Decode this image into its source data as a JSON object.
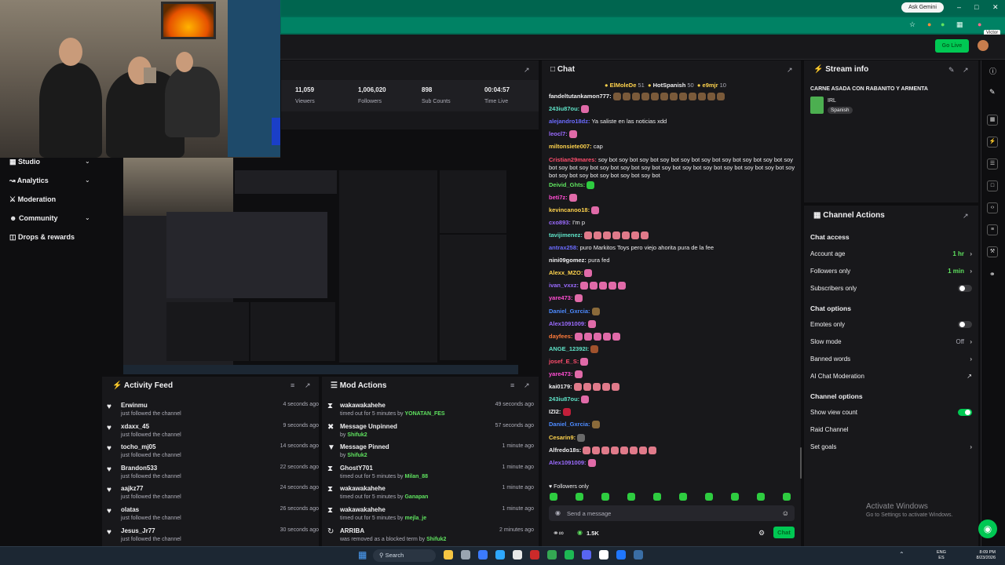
{
  "browser": {
    "gemini_label": "Ask Gemini",
    "tooltip": "Victor",
    "go_live": "Go Live"
  },
  "sidebar": {
    "items": [
      {
        "label": "Studio",
        "chevron": true
      },
      {
        "label": "Analytics",
        "chevron": true
      },
      {
        "label": "Moderation",
        "chevron": false
      },
      {
        "label": "Community",
        "chevron": true
      },
      {
        "label": "Drops & rewards",
        "chevron": false
      }
    ]
  },
  "stats": [
    {
      "value": "11,059",
      "label": "Viewers"
    },
    {
      "value": "1,006,020",
      "label": "Followers"
    },
    {
      "value": "898",
      "label": "Sub Counts"
    },
    {
      "value": "00:04:57",
      "label": "Time Live"
    }
  ],
  "activity_feed": {
    "title": "Activity Feed",
    "items": [
      {
        "name": "Erwinmu",
        "sub": "just followed the channel",
        "time": "4 seconds ago"
      },
      {
        "name": "xdaxx_45",
        "sub": "just followed the channel",
        "time": "9 seconds ago"
      },
      {
        "name": "tocho_mj05",
        "sub": "just followed the channel",
        "time": "14 seconds ago"
      },
      {
        "name": "Brandon533",
        "sub": "just followed the channel",
        "time": "22 seconds ago"
      },
      {
        "name": "aajkz77",
        "sub": "just followed the channel",
        "time": "24 seconds ago"
      },
      {
        "name": "olatas",
        "sub": "just followed the channel",
        "time": "26 seconds ago"
      },
      {
        "name": "Jesus_Jr77",
        "sub": "just followed the channel",
        "time": "30 seconds ago"
      }
    ]
  },
  "mod_actions": {
    "title": "Mod Actions",
    "items": [
      {
        "icon": "hourglass-icon",
        "name": "wakawakahehe",
        "sub": "timed out for 5 minutes by ",
        "by": "YONATAN_FES",
        "time": "49 seconds ago"
      },
      {
        "icon": "unpin-icon",
        "name": "Message Unpinned",
        "sub": "by ",
        "by": "Shifuk2",
        "time": "57 seconds ago"
      },
      {
        "icon": "pin-icon",
        "name": "Message Pinned",
        "sub": "by ",
        "by": "Shifuk2",
        "time": "1 minute ago"
      },
      {
        "icon": "hourglass-icon",
        "name": "GhostY701",
        "sub": "timed out for 5 minutes by ",
        "by": "Milan_88",
        "time": "1 minute ago"
      },
      {
        "icon": "hourglass-icon",
        "name": "wakawakahehe",
        "sub": "timed out for 5 minutes by ",
        "by": "Ganapan",
        "time": "1 minute ago"
      },
      {
        "icon": "hourglass-icon",
        "name": "wakawakahehe",
        "sub": "timed out for 5 minutes by ",
        "by": "mejla_je",
        "time": "1 minute ago"
      },
      {
        "icon": "refresh-icon",
        "name": "ARRIBA",
        "sub": "was removed as a blocked term by ",
        "by": "Shifuk2",
        "time": "2 minutes ago"
      }
    ]
  },
  "chat": {
    "title": "Chat",
    "leaders": [
      {
        "name": "ElMoleDe",
        "count": "51"
      },
      {
        "name": "HotSpanish",
        "count": "50"
      },
      {
        "name": "e9mjr",
        "count": "10"
      }
    ],
    "messages": [
      {
        "user": "fandeltutankamon777:",
        "color": "#efeff1",
        "text": "",
        "emotes": 12,
        "emote_color": "#7a5a3a"
      },
      {
        "user": "243iu87ou:",
        "color": "#5fe3c8",
        "text": "",
        "emotes": 1,
        "emote_color": "#e06aa8"
      },
      {
        "user": "alejandro18dz:",
        "color": "#6b6bff",
        "text": "Ya saliste en las noticias xdd",
        "emotes": 0,
        "emote_color": ""
      },
      {
        "user": "leocl7:",
        "color": "#9b6bff",
        "text": "",
        "emotes": 1,
        "emote_color": "#e06aa8"
      },
      {
        "user": "miltonsiete007:",
        "color": "#ffd34d",
        "text": "cap",
        "emotes": 0,
        "emote_color": ""
      },
      {
        "user": "Cristian29mares:",
        "color": "#ff4d6d",
        "text": "soy bot soy bot soy bot soy bot soy bot soy bot soy bot soy bot soy bot soy bot soy bot soy bot soy bot soy bot soy bot soy bot soy bot soy bot soy bot soy bot soy bot soy bot soy bot soy bot soy bot soy bot soy bot",
        "emotes": 0,
        "emote_color": "",
        "wrap": true
      },
      {
        "user": "Deivid_Ghts:",
        "color": "#5fe35f",
        "text": "",
        "emotes": 1,
        "emote_color": "#2ecc40"
      },
      {
        "user": "beti7z:",
        "color": "#ff4dd2",
        "text": "",
        "emotes": 1,
        "emote_color": "#e06aa8"
      },
      {
        "user": "kevincanoo18:",
        "color": "#ffd34d",
        "text": "",
        "emotes": 1,
        "emote_color": "#e06aa8"
      },
      {
        "user": "cxo893:",
        "color": "#9b6bff",
        "text": "I'm p",
        "emotes": 0,
        "emote_color": ""
      },
      {
        "user": "tavijimenez:",
        "color": "#5fe3c8",
        "text": "",
        "emotes": 7,
        "emote_color": "#e07a8a"
      },
      {
        "user": "antrax258:",
        "color": "#6b6bff",
        "text": "puro Markitos Toys pero viejo ahorita pura de la fee",
        "emotes": 0,
        "emote_color": ""
      },
      {
        "user": "nini09gomez:",
        "color": "#efeff1",
        "text": "pura fed",
        "emotes": 0,
        "emote_color": ""
      },
      {
        "user": "Alexx_MZO:",
        "color": "#ffd34d",
        "text": "",
        "emotes": 1,
        "emote_color": "#e06aa8"
      },
      {
        "user": "ivan_vxxz:",
        "color": "#9b6bff",
        "text": "",
        "emotes": 5,
        "emote_color": "#e06aa8"
      },
      {
        "user": "yare473:",
        "color": "#ff4dd2",
        "text": "",
        "emotes": 1,
        "emote_color": "#e06aa8"
      },
      {
        "user": "Daniel_Gxrcia:",
        "color": "#4d8bff",
        "text": "",
        "emotes": 1,
        "emote_color": "#8a6a3a"
      },
      {
        "user": "Alex1091009:",
        "color": "#9b6bff",
        "text": "",
        "emotes": 1,
        "emote_color": "#e06aa8"
      },
      {
        "user": "dayfees:",
        "color": "#ff7a3a",
        "text": "",
        "emotes": 5,
        "emote_color": "#e06aa8"
      },
      {
        "user": "ANGE_12392I:",
        "color": "#5fe3c8",
        "text": "",
        "emotes": 1,
        "emote_color": "#a0522d"
      },
      {
        "user": "josef_E_S:",
        "color": "#ff4d6d",
        "text": "",
        "emotes": 1,
        "emote_color": "#e06aa8"
      },
      {
        "user": "yare473:",
        "color": "#ff4dd2",
        "text": "",
        "emotes": 1,
        "emote_color": "#e06aa8"
      },
      {
        "user": "kai0179:",
        "color": "#efeff1",
        "text": "",
        "emotes": 5,
        "emote_color": "#e07a8a"
      },
      {
        "user": "243iu87ou:",
        "color": "#5fe3c8",
        "text": "",
        "emotes": 1,
        "emote_color": "#e06aa8"
      },
      {
        "user": "IZI2:",
        "color": "#efeff1",
        "text": "",
        "emotes": 1,
        "emote_color": "#c21f3a"
      },
      {
        "user": "Daniel_Gxrcia:",
        "color": "#4d8bff",
        "text": "",
        "emotes": 1,
        "emote_color": "#8a6a3a"
      },
      {
        "user": "Cesarin9:",
        "color": "#ffd34d",
        "text": "",
        "emotes": 1,
        "emote_color": "#6a6a6a"
      },
      {
        "user": "Alfredo18s:",
        "color": "#efeff1",
        "text": "",
        "emotes": 8,
        "emote_color": "#e07a8a"
      },
      {
        "user": "Alex1091009:",
        "color": "#9b6bff",
        "text": "",
        "emotes": 1,
        "emote_color": "#e06aa8"
      }
    ],
    "followers_only": "Followers only",
    "placeholder": "Send a message",
    "viewer_count": "1.5K",
    "chat_button": "Chat"
  },
  "stream_info": {
    "title": "Stream info",
    "stream_title": "CARNE ASADA CON RABANITO Y ARMENTA",
    "category": "IRL",
    "tag": "Spanish"
  },
  "channel_actions": {
    "title": "Channel Actions",
    "chat_access_heading": "Chat access",
    "account_age": {
      "label": "Account age",
      "value": "1 hr"
    },
    "followers_only": {
      "label": "Followers only",
      "value": "1 min"
    },
    "subscribers_only": {
      "label": "Subscribers only"
    },
    "chat_options_heading": "Chat options",
    "emotes_only": {
      "label": "Emotes only"
    },
    "slow_mode": {
      "label": "Slow mode",
      "value": "Off"
    },
    "banned_words": {
      "label": "Banned words"
    },
    "ai_moderation": {
      "label": "AI Chat Moderation"
    },
    "channel_options_heading": "Channel options",
    "show_view_count": {
      "label": "Show view count"
    },
    "raid_channel": {
      "label": "Raid Channel"
    },
    "set_goals": {
      "label": "Set goals"
    }
  },
  "watermark": {
    "line1": "Activate Windows",
    "line2": "Go to Settings to activate Windows."
  },
  "taskbar": {
    "search": "Search",
    "lang": "ENG",
    "region": "ES",
    "time": "8:09 PM",
    "date": "8/23/2026"
  }
}
